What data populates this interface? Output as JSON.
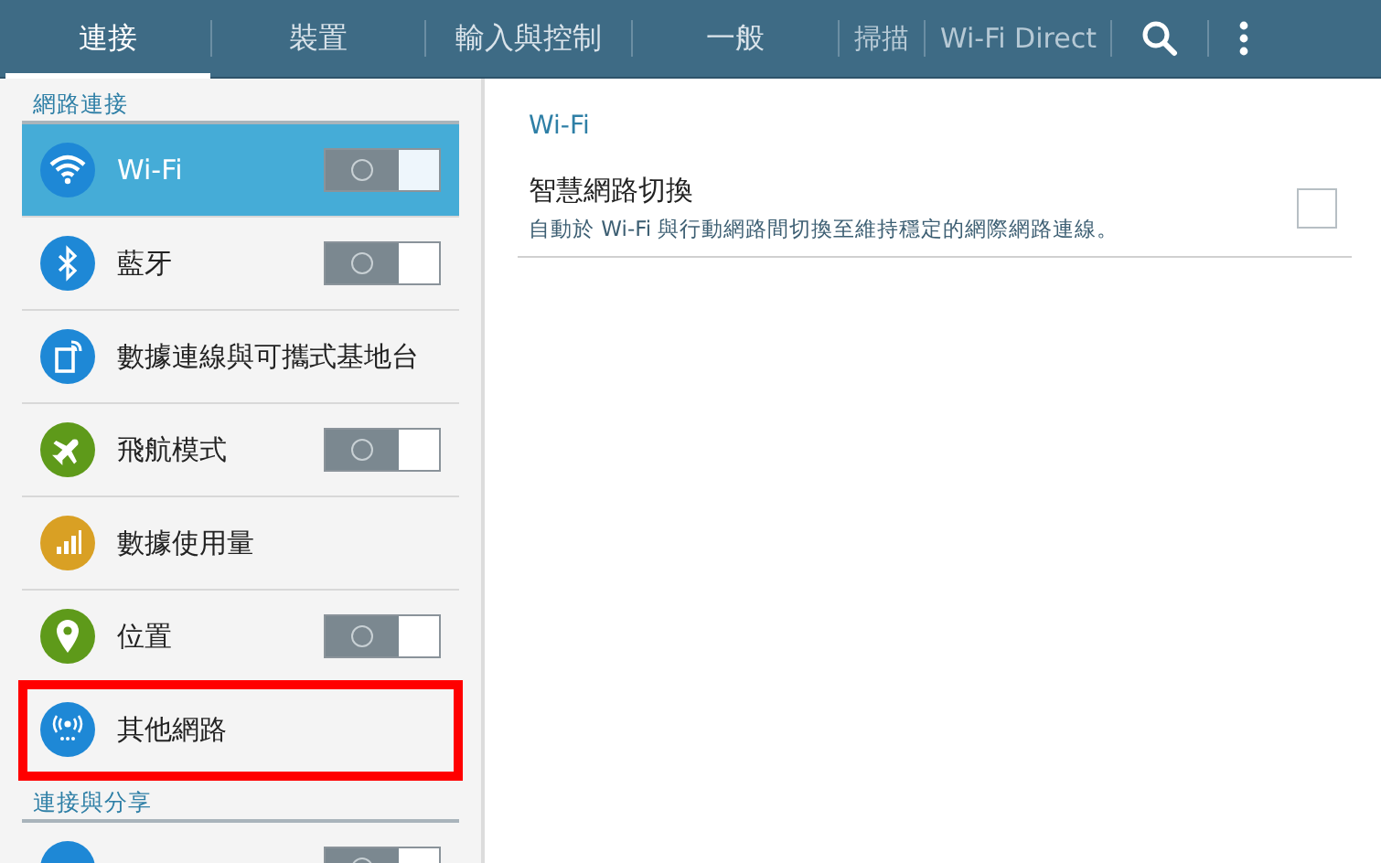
{
  "tabs": [
    {
      "label": "連接",
      "selected": true
    },
    {
      "label": "裝置",
      "selected": false
    },
    {
      "label": "輸入與控制",
      "selected": false
    },
    {
      "label": "一般",
      "selected": false
    }
  ],
  "actions": [
    "掃描",
    "Wi-Fi Direct"
  ],
  "sidebar": {
    "sections": [
      {
        "title": "網路連接",
        "items": [
          {
            "label": "Wi-Fi",
            "color": "#1e88d6",
            "kind": "toggle",
            "on": false,
            "selected": true,
            "highlighted": false
          },
          {
            "label": "藍牙",
            "color": "#1e88d6",
            "kind": "toggle",
            "on": false,
            "selected": false,
            "highlighted": false
          },
          {
            "label": "數據連線與可攜式基地台",
            "color": "#1e88d6",
            "kind": "plain",
            "selected": false,
            "highlighted": false
          },
          {
            "label": "飛航模式",
            "color": "#5e9a1a",
            "kind": "toggle",
            "on": false,
            "selected": false,
            "highlighted": false
          },
          {
            "label": "數據使用量",
            "color": "#d9a024",
            "kind": "plain",
            "selected": false,
            "highlighted": false
          },
          {
            "label": "位置",
            "color": "#5e9a1a",
            "kind": "toggle",
            "on": false,
            "selected": false,
            "highlighted": false
          },
          {
            "label": "其他網路",
            "color": "#1e88d6",
            "kind": "plain",
            "selected": false,
            "highlighted": true
          }
        ]
      },
      {
        "title": "連接與分享",
        "items": [
          {
            "color": "#1e88d6",
            "kind": "toggle",
            "on": false,
            "selected": false,
            "highlighted": false
          }
        ]
      }
    ]
  },
  "detail": {
    "title": "Wi-Fi",
    "settings": [
      {
        "label": "智慧網路切換",
        "description": "自動於 Wi-Fi 與行動網路間切換至維持穩定的網際網路連線。",
        "checked": false
      }
    ]
  }
}
